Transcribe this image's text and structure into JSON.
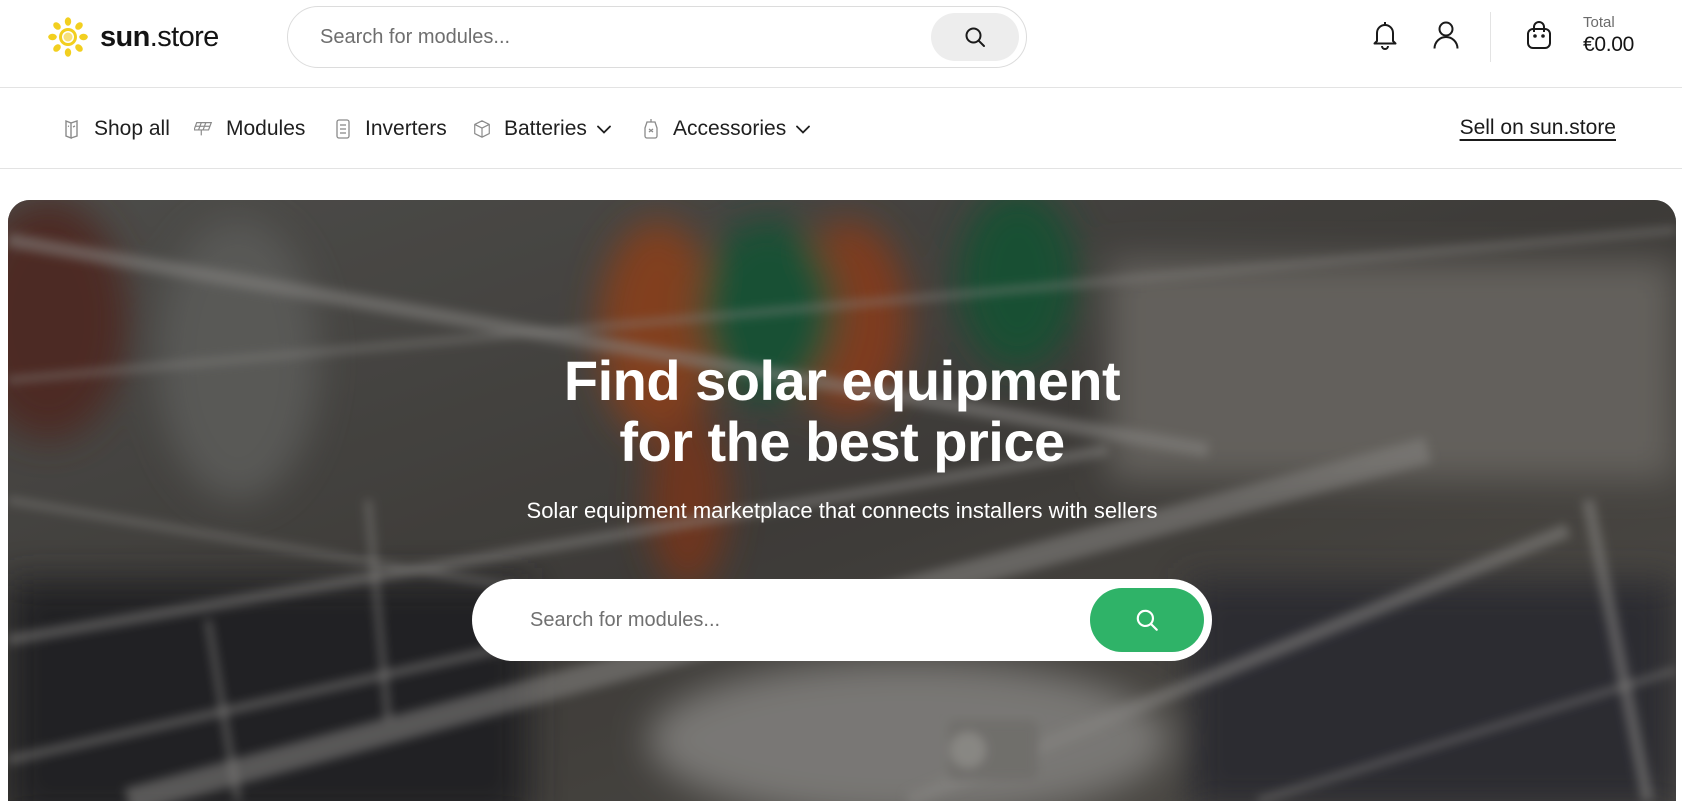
{
  "header": {
    "logo": {
      "bold": "sun",
      "rest": ".store"
    },
    "search": {
      "placeholder": "Search for modules..."
    },
    "cart": {
      "total_label": "Total",
      "total_value": "€0.00"
    },
    "icons": [
      "search-icon",
      "bell-icon",
      "user-icon",
      "shopping-bag-icon"
    ]
  },
  "nav": {
    "items": [
      {
        "label": "Shop all",
        "icon": "shop-all-icon"
      },
      {
        "label": "Modules",
        "icon": "solar-panel-icon"
      },
      {
        "label": "Inverters",
        "icon": "inverter-icon"
      },
      {
        "label": "Batteries",
        "icon": "battery-icon",
        "dropdown": true
      },
      {
        "label": "Accessories",
        "icon": "accessories-icon",
        "dropdown": true
      }
    ],
    "sell_link": "Sell on sun.store"
  },
  "hero": {
    "title_line1": "Find solar equipment",
    "title_line2": "for the best price",
    "subtitle": "Solar equipment marketplace that connects installers with sellers",
    "search": {
      "placeholder": "Search for modules..."
    }
  },
  "colors": {
    "accent_green": "#2fb368",
    "logo_yellow": "#f2cf1f",
    "text_dark": "#1a1a1a",
    "border": "#e3e3e3"
  }
}
